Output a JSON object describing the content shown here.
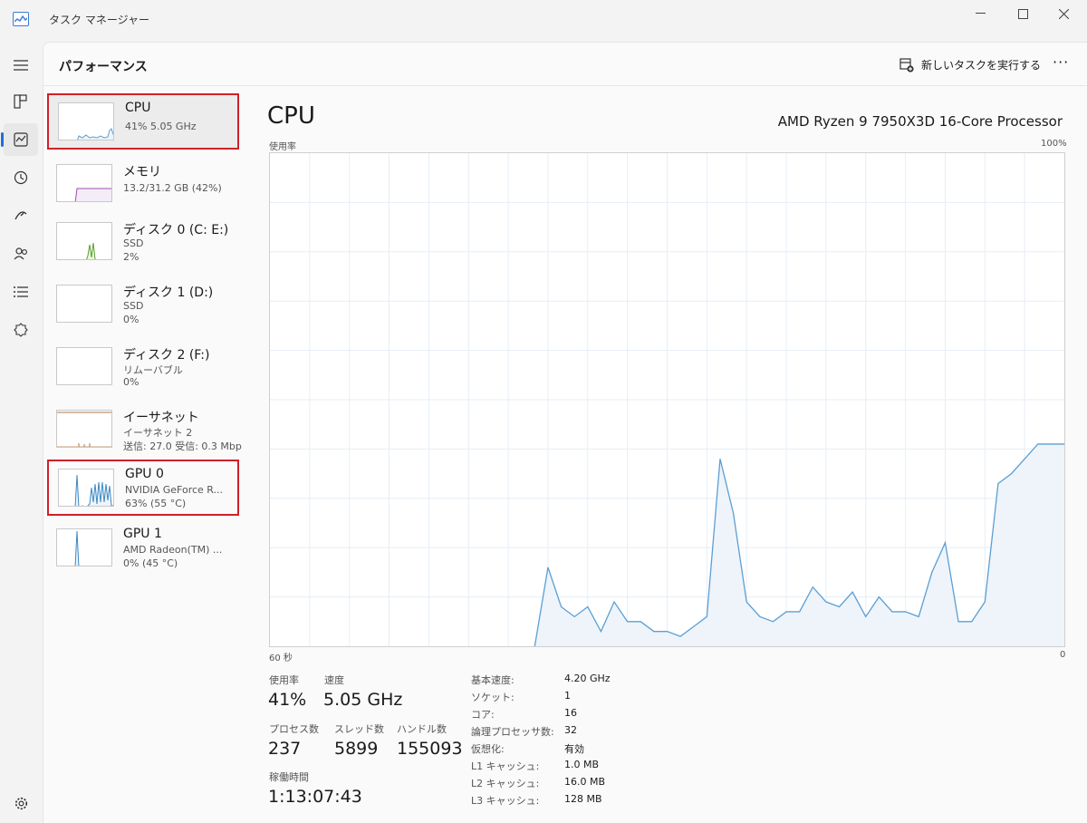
{
  "window": {
    "title": "タスク マネージャー"
  },
  "header": {
    "title": "パフォーマンス",
    "run_task": "新しいタスクを実行する"
  },
  "resources": [
    {
      "name": "CPU",
      "line1": "41%  5.05 GHz",
      "line2": "",
      "line3": ""
    },
    {
      "name": "メモリ",
      "line1": "13.2/31.2 GB (42%)",
      "line2": "",
      "line3": ""
    },
    {
      "name": "ディスク 0 (C: E:)",
      "line1": "SSD",
      "line2": "2%",
      "line3": ""
    },
    {
      "name": "ディスク 1 (D:)",
      "line1": "SSD",
      "line2": "0%",
      "line3": ""
    },
    {
      "name": "ディスク 2 (F:)",
      "line1": "リムーバブル",
      "line2": "0%",
      "line3": ""
    },
    {
      "name": "イーサネット",
      "line1": "イーサネット 2",
      "line2": "送信: 27.0  受信: 0.3 Mbp",
      "line3": ""
    },
    {
      "name": "GPU 0",
      "line1": "NVIDIA GeForce R...",
      "line2": "63%  (55 °C)",
      "line3": ""
    },
    {
      "name": "GPU 1",
      "line1": "AMD Radeon(TM) ...",
      "line2": "0%  (45 °C)",
      "line3": ""
    }
  ],
  "detail": {
    "title": "CPU",
    "model": "AMD Ryzen 9 7950X3D 16-Core Processor",
    "graph_label": "使用率",
    "graph_max": "100%",
    "graph_time": "60 秒",
    "graph_min": "0"
  },
  "stats": {
    "usage_label": "使用率",
    "usage_value": "41%",
    "speed_label": "速度",
    "speed_value": "5.05 GHz",
    "proc_label": "プロセス数",
    "proc_value": "237",
    "thread_label": "スレッド数",
    "thread_value": "5899",
    "handle_label": "ハンドル数",
    "handle_value": "155093",
    "uptime_label": "稼働時間",
    "uptime_value": "1:13:07:43"
  },
  "specs": [
    {
      "key": "基本速度:",
      "value": "4.20 GHz"
    },
    {
      "key": "ソケット:",
      "value": "1"
    },
    {
      "key": "コア:",
      "value": "16"
    },
    {
      "key": "論理プロセッサ数:",
      "value": "32"
    },
    {
      "key": "仮想化:",
      "value": "有効"
    },
    {
      "key": "L1 キャッシュ:",
      "value": "1.0 MB"
    },
    {
      "key": "L2 キャッシュ:",
      "value": "16.0 MB"
    },
    {
      "key": "L3 キャッシュ:",
      "value": "128 MB"
    }
  ],
  "chart_data": {
    "type": "area",
    "ylabel": "使用率",
    "ylim": [
      0,
      100
    ],
    "x_span": "60 秒",
    "x": [
      0,
      1,
      2,
      3,
      4,
      5,
      6,
      7,
      8,
      9,
      10,
      11,
      12,
      13,
      14,
      15,
      16,
      17,
      18,
      19,
      20,
      21,
      22,
      23,
      24,
      25,
      26,
      27,
      28,
      29,
      30,
      31,
      32,
      33,
      34,
      35,
      36,
      37,
      38,
      39,
      40,
      41,
      42,
      43,
      44,
      45,
      46,
      47,
      48,
      49,
      50,
      51,
      52,
      53,
      54,
      55,
      56,
      57,
      58,
      59,
      60
    ],
    "y": [
      0,
      0,
      0,
      0,
      0,
      0,
      0,
      0,
      0,
      0,
      0,
      0,
      0,
      0,
      0,
      0,
      0,
      0,
      0,
      0,
      0,
      16,
      8,
      6,
      8,
      3,
      9,
      5,
      5,
      3,
      3,
      2,
      4,
      6,
      38,
      27,
      9,
      6,
      5,
      7,
      7,
      12,
      9,
      8,
      11,
      6,
      10,
      7,
      7,
      6,
      15,
      21,
      5,
      5,
      9,
      33,
      35,
      38,
      41,
      41,
      41
    ],
    "color": "#5a9fd4",
    "fill": "#eef4fa"
  }
}
